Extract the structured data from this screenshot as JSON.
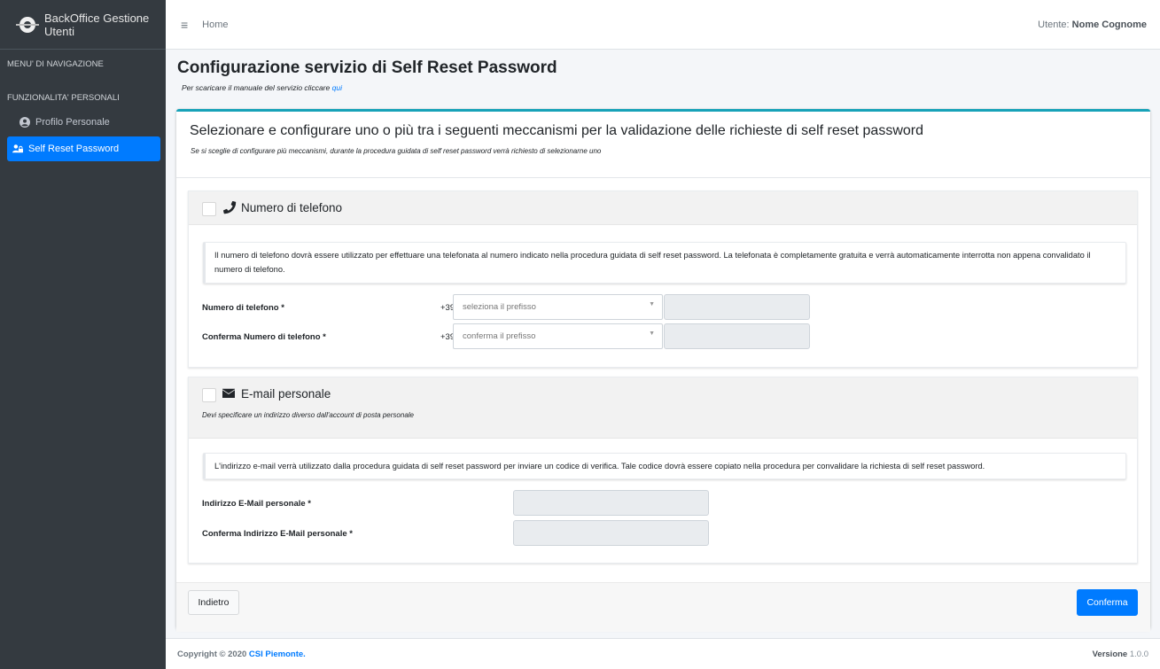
{
  "sidebar": {
    "brand": "BackOffice Gestione Utenti",
    "nav_header": "MENU' DI NAVIGAZIONE",
    "section_header": "FUNZIONALITA' PERSONALI",
    "items": [
      {
        "label": "Profilo Personale",
        "icon": "user-circle-icon",
        "active": false
      },
      {
        "label": "Self Reset Password",
        "icon": "user-lock-icon",
        "active": true
      }
    ]
  },
  "topbar": {
    "home": "Home",
    "user_prefix": "Utente:",
    "user_name": "Nome Cognome"
  },
  "page": {
    "title": "Configurazione servizio di Self Reset Password",
    "subtitle_text": "Per scaricare il manuale del servizio cliccare",
    "subtitle_link": "qui"
  },
  "card": {
    "title": "Selezionare e configurare uno o più tra i seguenti meccanismi per la validazione delle richieste di self reset password",
    "description": "Se si sceglie di configurare più meccanismi, durante la procedura guidata di self reset password verrà richiesto di selezionarne uno"
  },
  "phone": {
    "title": "Numero di telefono",
    "icon": "phone-icon",
    "checked": false,
    "info": "Il numero di telefono dovrà essere utilizzato per effettuare una telefonata al numero indicato nella procedura guidata di self reset password. La telefonata è completamente gratuita e verrà automaticamente interrotta non appena convalidato il numero di telefono.",
    "field1_label": "Numero di telefono *",
    "field1_prefix": "+39",
    "field1_placeholder": "seleziona il prefisso",
    "field1_value": "",
    "field2_label": "Conferma Numero di telefono *",
    "field2_prefix": "+39",
    "field2_placeholder": "conferma il prefisso",
    "field2_value": ""
  },
  "email": {
    "title": "E-mail personale",
    "icon": "envelope-icon",
    "checked": false,
    "note": "Devi specificare un indirizzo diverso dall'account di posta personale",
    "info": "L'indirizzo e-mail verrà utilizzato dalla procedura guidata di self reset password per inviare un codice di verifica. Tale codice dovrà essere copiato nella procedura per convalidare la richiesta di self reset password.",
    "field1_label": "Indirizzo E-Mail personale *",
    "field1_value": "",
    "field2_label": "Conferma Indirizzo E-Mail personale *",
    "field2_value": ""
  },
  "buttons": {
    "back": "Indietro",
    "confirm": "Conferma"
  },
  "footer": {
    "copyright": "Copyright © 2020",
    "org": "CSI Piemonte.",
    "version_label": "Versione",
    "version_value": "1.0.0"
  },
  "colors": {
    "sidebar_bg": "#343a40",
    "accent": "#007bff",
    "card_top_border": "#17a2b8"
  }
}
